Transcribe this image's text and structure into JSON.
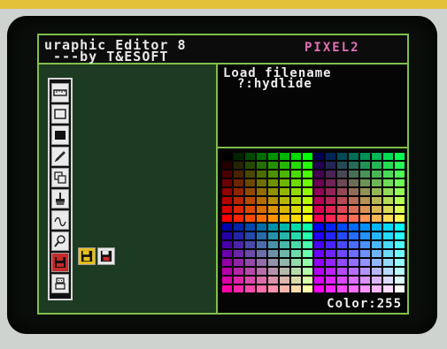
{
  "header": {
    "title_line1": "uraphic Editor 8",
    "title_line2": " ---by T&ESOFT",
    "mode_label": "PIXEL2"
  },
  "load_panel": {
    "title": "Load filename",
    "prompt": " ?:hydlide"
  },
  "palette": {
    "color_label": "Color:255",
    "selected_index": 255
  },
  "toolbar": {
    "tools": [
      {
        "icon": "ruler-icon"
      },
      {
        "icon": "rectangle-outline-icon"
      },
      {
        "icon": "filled-rectangle-icon"
      },
      {
        "icon": "pencil-icon"
      },
      {
        "icon": "copy-stamp-icon"
      },
      {
        "icon": "paint-brush-icon"
      },
      {
        "icon": "curve-icon"
      },
      {
        "icon": "magnifier-icon"
      },
      {
        "icon": "disk-icon",
        "active": true
      },
      {
        "icon": "robot-icon"
      }
    ],
    "disk_options": [
      {
        "icon": "disk-save-icon",
        "color": "#e8c020"
      },
      {
        "icon": "disk-load-icon",
        "color": "#e8e8e8"
      }
    ]
  },
  "colors": {
    "frame": "#7fbf4a",
    "mode_label": "#e071b6",
    "active_tool": "#c82a2a"
  }
}
